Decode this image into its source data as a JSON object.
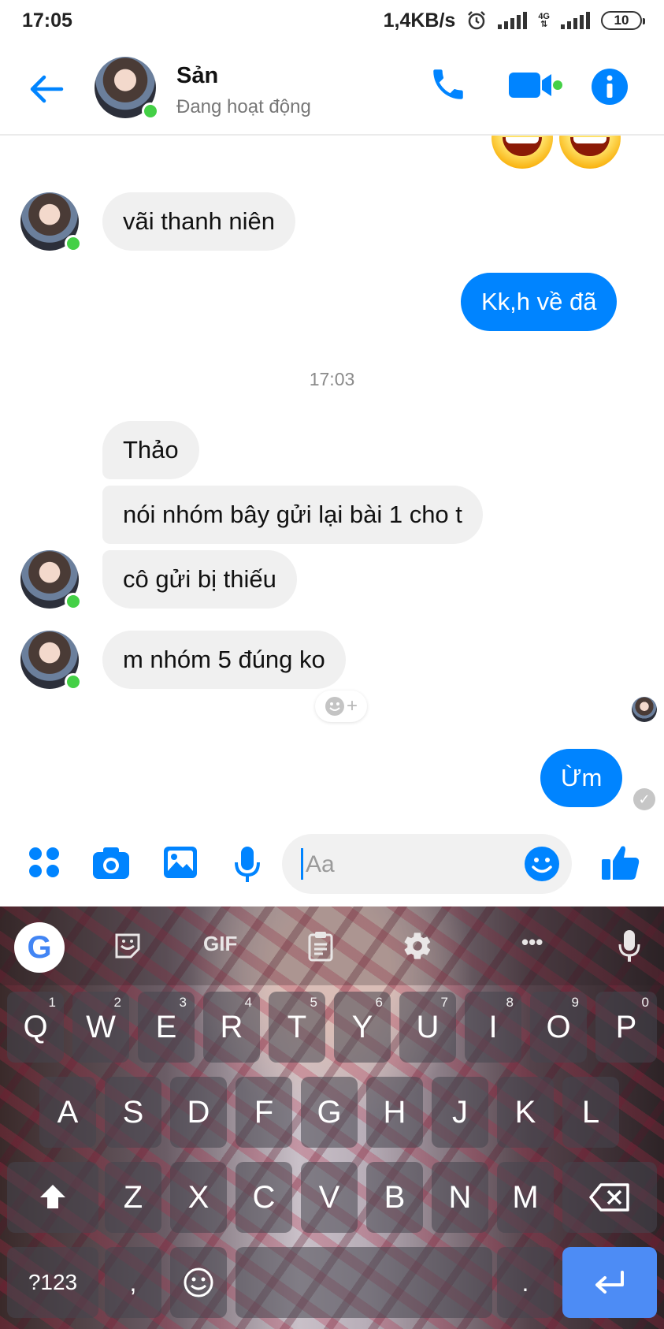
{
  "status_bar": {
    "time": "17:05",
    "speed": "1,4KB/s",
    "network": "4G",
    "battery": "10"
  },
  "header": {
    "contact_name": "Sản",
    "contact_status": "Đang hoạt động",
    "icons": [
      "back-arrow-icon",
      "phone-icon",
      "video-call-icon",
      "info-icon"
    ],
    "accent_color": "#0084ff",
    "online_color": "#44d046"
  },
  "messages": [
    {
      "from": "them",
      "text": "vãi thanh niên"
    },
    {
      "from": "me",
      "text": "Kk,h về đã"
    },
    {
      "timestamp": "17:03"
    },
    {
      "from": "them",
      "text": "Thảo"
    },
    {
      "from": "them",
      "text": "nói nhóm bây gửi lại bài 1 cho t"
    },
    {
      "from": "them",
      "text": "cô gửi bị thiếu"
    },
    {
      "from": "them",
      "text": "m nhóm 5 đúng ko"
    },
    {
      "from": "me",
      "text": "Ừm"
    }
  ],
  "composer": {
    "placeholder": "Aa",
    "tools": [
      "apps-icon",
      "camera-icon",
      "gallery-icon",
      "microphone-icon",
      "emoji-icon",
      "like-icon"
    ]
  },
  "keyboard": {
    "toolbar": {
      "google": "G",
      "gif": "GIF",
      "more": "•••"
    },
    "row1": [
      {
        "key": "Q",
        "hint": "1"
      },
      {
        "key": "W",
        "hint": "2"
      },
      {
        "key": "E",
        "hint": "3"
      },
      {
        "key": "R",
        "hint": "4"
      },
      {
        "key": "T",
        "hint": "5"
      },
      {
        "key": "Y",
        "hint": "6"
      },
      {
        "key": "U",
        "hint": "7"
      },
      {
        "key": "I",
        "hint": "8"
      },
      {
        "key": "O",
        "hint": "9"
      },
      {
        "key": "P",
        "hint": "0"
      }
    ],
    "row2": [
      "A",
      "S",
      "D",
      "F",
      "G",
      "H",
      "J",
      "K",
      "L"
    ],
    "row3": [
      "Z",
      "X",
      "C",
      "V",
      "B",
      "N",
      "M"
    ],
    "symbols_key": "?123",
    "comma_key": ",",
    "period_key": "."
  }
}
